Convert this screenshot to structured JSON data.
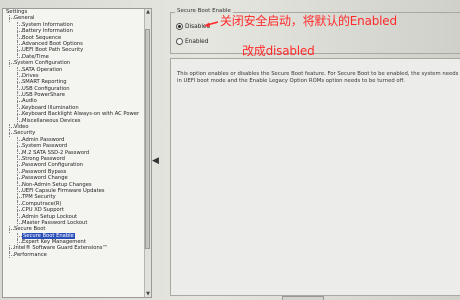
{
  "tree": {
    "items": [
      {
        "label": "Settings",
        "depth": 0
      },
      {
        "label": "General",
        "depth": 1,
        "expander": "minus"
      },
      {
        "label": "System Information",
        "depth": 2
      },
      {
        "label": "Battery Information",
        "depth": 2
      },
      {
        "label": "Boot Sequence",
        "depth": 2
      },
      {
        "label": "Advanced Boot Options",
        "depth": 2
      },
      {
        "label": "UEFI Boot Path Security",
        "depth": 2
      },
      {
        "label": "Date/Time",
        "depth": 2
      },
      {
        "label": "System Configuration",
        "depth": 1,
        "expander": "minus"
      },
      {
        "label": "SATA Operation",
        "depth": 2
      },
      {
        "label": "Drives",
        "depth": 2
      },
      {
        "label": "SMART Reporting",
        "depth": 2
      },
      {
        "label": "USB Configuration",
        "depth": 2
      },
      {
        "label": "USB PowerShare",
        "depth": 2
      },
      {
        "label": "Audio",
        "depth": 2
      },
      {
        "label": "Keyboard Illumination",
        "depth": 2
      },
      {
        "label": "Keyboard Backlight Always-on with AC Power",
        "depth": 2
      },
      {
        "label": "Miscellaneous Devices",
        "depth": 2
      },
      {
        "label": "Video",
        "depth": 1,
        "expander": "plus"
      },
      {
        "label": "Security",
        "depth": 1,
        "expander": "minus"
      },
      {
        "label": "Admin Password",
        "depth": 2
      },
      {
        "label": "System Password",
        "depth": 2
      },
      {
        "label": "M.2 SATA SSD-2 Password",
        "depth": 2
      },
      {
        "label": "Strong Password",
        "depth": 2
      },
      {
        "label": "Password Configuration",
        "depth": 2
      },
      {
        "label": "Password Bypass",
        "depth": 2
      },
      {
        "label": "Password Change",
        "depth": 2
      },
      {
        "label": "Non-Admin Setup Changes",
        "depth": 2
      },
      {
        "label": "UEFI Capsule Firmware Updates",
        "depth": 2
      },
      {
        "label": "TPM Security",
        "depth": 2
      },
      {
        "label": "Computrace(R)",
        "depth": 2
      },
      {
        "label": "CPU XD Support",
        "depth": 2
      },
      {
        "label": "Admin Setup Lockout",
        "depth": 2
      },
      {
        "label": "Master Password Lockout",
        "depth": 2
      },
      {
        "label": "Secure Boot",
        "depth": 1,
        "expander": "minus"
      },
      {
        "label": "Secure Boot Enable",
        "depth": 2,
        "selected": true
      },
      {
        "label": "Expert Key Management",
        "depth": 2
      },
      {
        "label": "Intel® Software Guard Extensions™",
        "depth": 1,
        "expander": "plus"
      },
      {
        "label": "Performance",
        "depth": 1,
        "expander": "plus"
      }
    ]
  },
  "group": {
    "title": "Secure Boot Enable",
    "options": [
      {
        "label": "Disabled",
        "selected": true
      },
      {
        "label": "Enabled",
        "selected": false
      }
    ]
  },
  "description": "This option enables or disables the Secure Boot feature. For Secure Boot to be enabled, the system needs to be in UEFI boot mode and the Enable Legacy Option ROMs option needs to be turned off.",
  "annotation": {
    "line1": "关闭安全启动，将默认的Enabled",
    "line2": "改成disabled",
    "color": "#ff2a2a"
  },
  "icons": {
    "collapse": "◀",
    "scroll_up": "▲",
    "scroll_down": "▼"
  }
}
